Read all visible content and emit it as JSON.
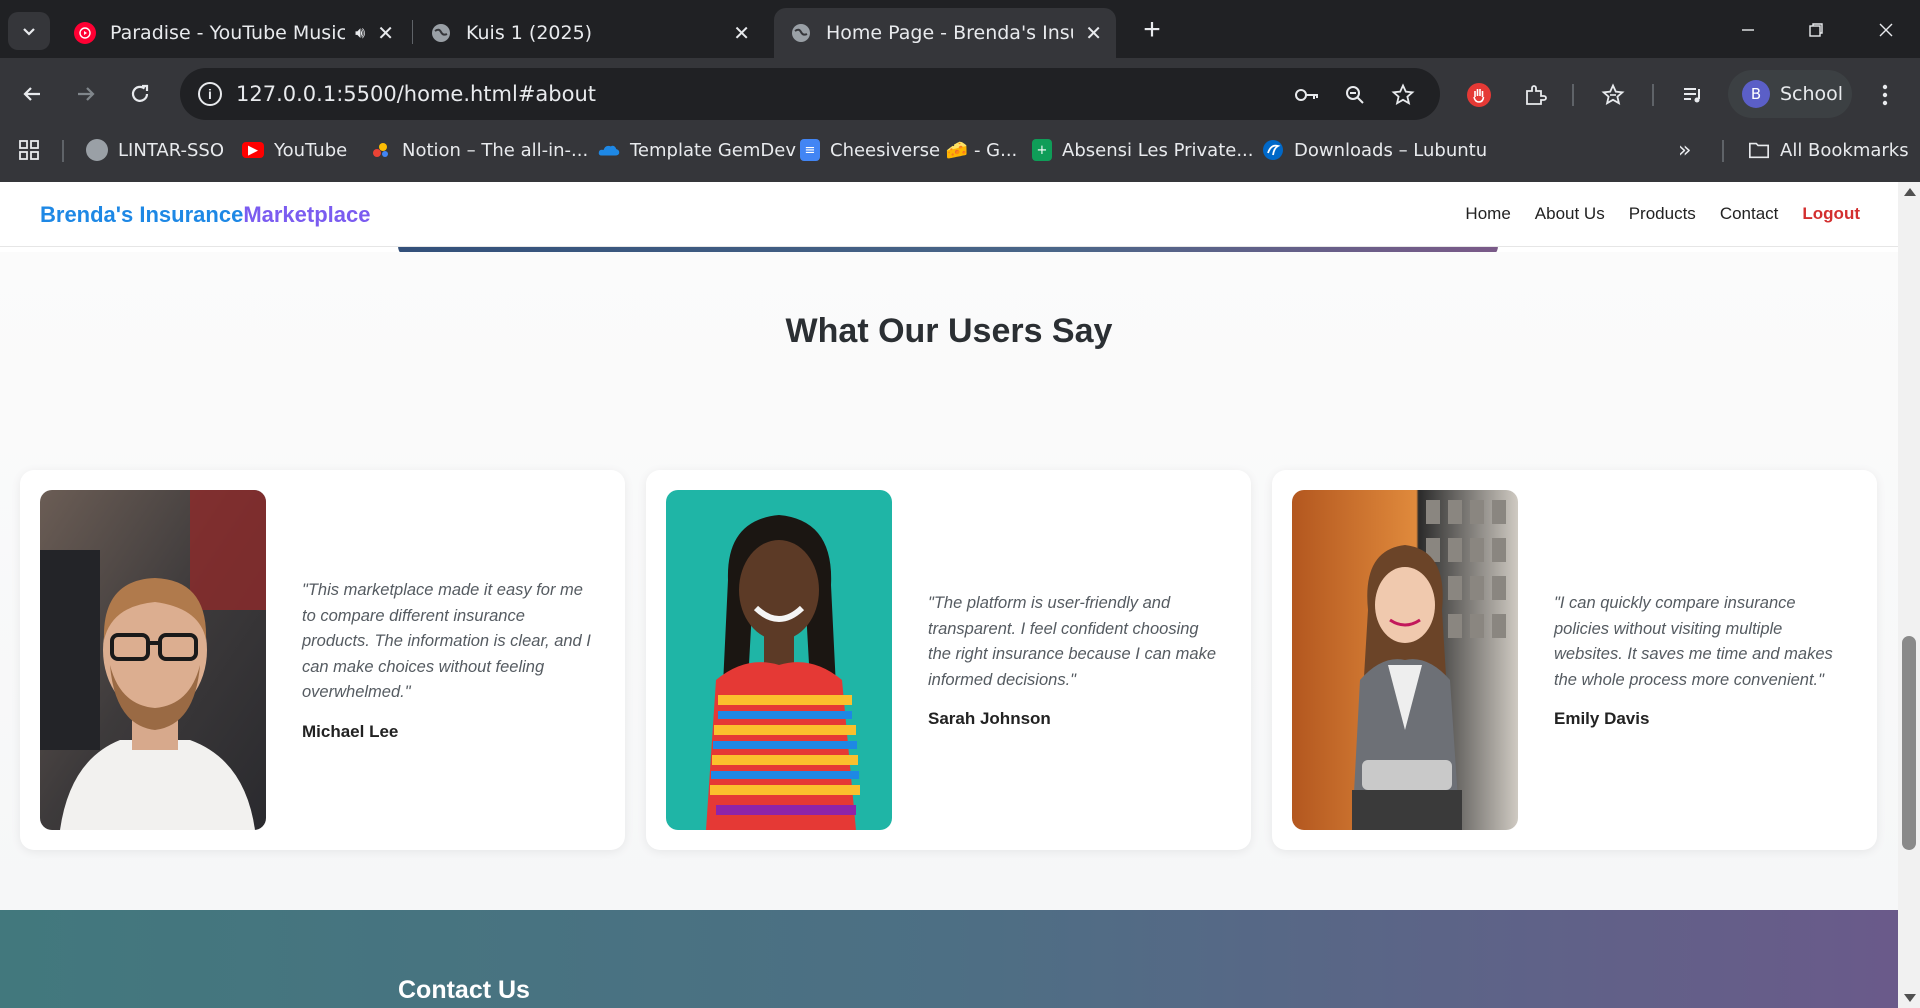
{
  "browser": {
    "tabs": [
      {
        "title": "Paradise - YouTube Music",
        "active": false,
        "favicon": "youtube-music-icon",
        "audio": true
      },
      {
        "title": "Kuis 1 (2025)",
        "active": false,
        "favicon": "globe-icon"
      },
      {
        "title": "Home Page - Brenda's Insurance",
        "active": true,
        "favicon": "globe-icon"
      }
    ],
    "url": "127.0.0.1:5500/home.html#about",
    "profile_initial": "B",
    "profile_name": "School",
    "bookmarks": [
      {
        "label": "LINTAR-SSO",
        "icon": "globe-icon"
      },
      {
        "label": "YouTube",
        "icon": "youtube-icon"
      },
      {
        "label": "Notion – The all-in-...",
        "icon": "notion-icon"
      },
      {
        "label": "Template GemDev",
        "icon": "onedrive-icon"
      },
      {
        "label": "Cheesiverse 🧀 - G...",
        "icon": "docs-icon"
      },
      {
        "label": "Absensi Les Private...",
        "icon": "sheets-icon"
      },
      {
        "label": "Downloads – Lubuntu",
        "icon": "lubuntu-icon"
      }
    ],
    "all_bookmarks": "All Bookmarks"
  },
  "site": {
    "brand_part1": "Brenda's Insurance",
    "brand_part2": "Marketplace",
    "nav": {
      "home": "Home",
      "about": "About Us",
      "products": "Products",
      "contact": "Contact",
      "logout": "Logout"
    }
  },
  "testimonials": {
    "title": "What Our Users Say",
    "items": [
      {
        "quote": "\"This marketplace made it easy for me to compare different insurance products. The information is clear, and I can make choices without feeling overwhelmed.\"",
        "name": "Michael Lee"
      },
      {
        "quote": "\"The platform is user-friendly and transparent. I feel confident choosing the right insurance because I can make informed decisions.\"",
        "name": "Sarah Johnson"
      },
      {
        "quote": "\"I can quickly compare insurance policies without visiting multiple websites. It saves me time and makes the whole process more convenient.\"",
        "name": "Emily Davis"
      }
    ]
  },
  "contact": {
    "title": "Contact Us"
  },
  "colors": {
    "brand_blue": "#1e88e5",
    "brand_purple": "#7b5cf0",
    "logout_red": "#d32f2f"
  }
}
